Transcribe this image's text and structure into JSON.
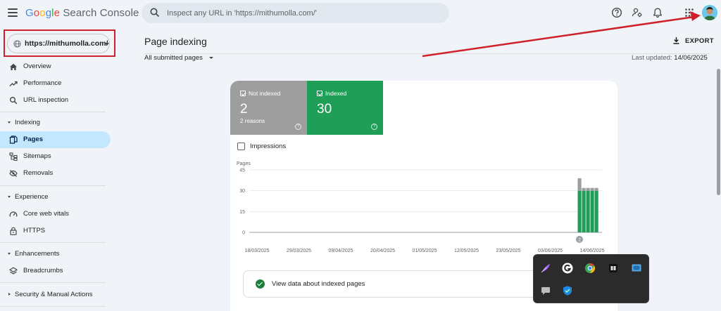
{
  "header": {
    "brand_google": "Google",
    "brand_product": "Search Console",
    "search_placeholder": "Inspect any URL in 'https://mithumolla.com/'",
    "icons": [
      "menu-icon",
      "search-icon",
      "help-icon",
      "manage-users-icon",
      "notifications-icon",
      "apps-grid-icon"
    ]
  },
  "sidebar": {
    "property": "https://mithumolla.com/",
    "top_items": [
      {
        "label": "Overview",
        "icon": "home-icon"
      },
      {
        "label": "Performance",
        "icon": "trending-icon"
      },
      {
        "label": "URL inspection",
        "icon": "search-icon"
      }
    ],
    "sections": [
      {
        "label": "Indexing",
        "items": [
          {
            "label": "Pages",
            "icon": "pages-icon",
            "active": true
          },
          {
            "label": "Sitemaps",
            "icon": "sitemap-icon"
          },
          {
            "label": "Removals",
            "icon": "removals-icon"
          }
        ]
      },
      {
        "label": "Experience",
        "items": [
          {
            "label": "Core web vitals",
            "icon": "gauge-icon"
          },
          {
            "label": "HTTPS",
            "icon": "lock-icon"
          }
        ]
      },
      {
        "label": "Enhancements",
        "items": [
          {
            "label": "Breadcrumbs",
            "icon": "layers-icon"
          }
        ]
      },
      {
        "label": "Security & Manual Actions",
        "items": []
      }
    ]
  },
  "main": {
    "title": "Page indexing",
    "export_label": "EXPORT",
    "filter_label": "All submitted pages",
    "last_updated_label": "Last updated:",
    "last_updated_value": "14/06/2025",
    "tiles": {
      "not_indexed": {
        "label": "Not indexed",
        "value": "2",
        "sub": "2 reasons"
      },
      "indexed": {
        "label": "Indexed",
        "value": "30"
      }
    },
    "impressions_label": "Impressions",
    "view_data_label": "View data about indexed pages"
  },
  "chart_data": {
    "type": "bar",
    "ylabel": "Pages",
    "yticks": [
      0,
      15,
      30,
      45
    ],
    "ylim": [
      0,
      45
    ],
    "xtick_labels": [
      "18/03/2025",
      "29/03/2025",
      "09/04/2025",
      "20/04/2025",
      "01/05/2025",
      "12/05/2025",
      "23/05/2025",
      "03/06/2025",
      "14/06/2025"
    ],
    "x": [
      "10/06/2025",
      "11/06/2025",
      "12/06/2025",
      "13/06/2025",
      "14/06/2025"
    ],
    "series": [
      {
        "name": "Indexed",
        "color": "#1e9e57",
        "values": [
          30,
          30,
          30,
          30,
          30
        ]
      },
      {
        "name": "Not indexed",
        "color": "#9e9e9e",
        "values": [
          9,
          2,
          2,
          2,
          2
        ]
      }
    ],
    "annotation": "2",
    "colors": {
      "indexed": "#1e9e57",
      "not_indexed": "#9e9e9e"
    }
  }
}
